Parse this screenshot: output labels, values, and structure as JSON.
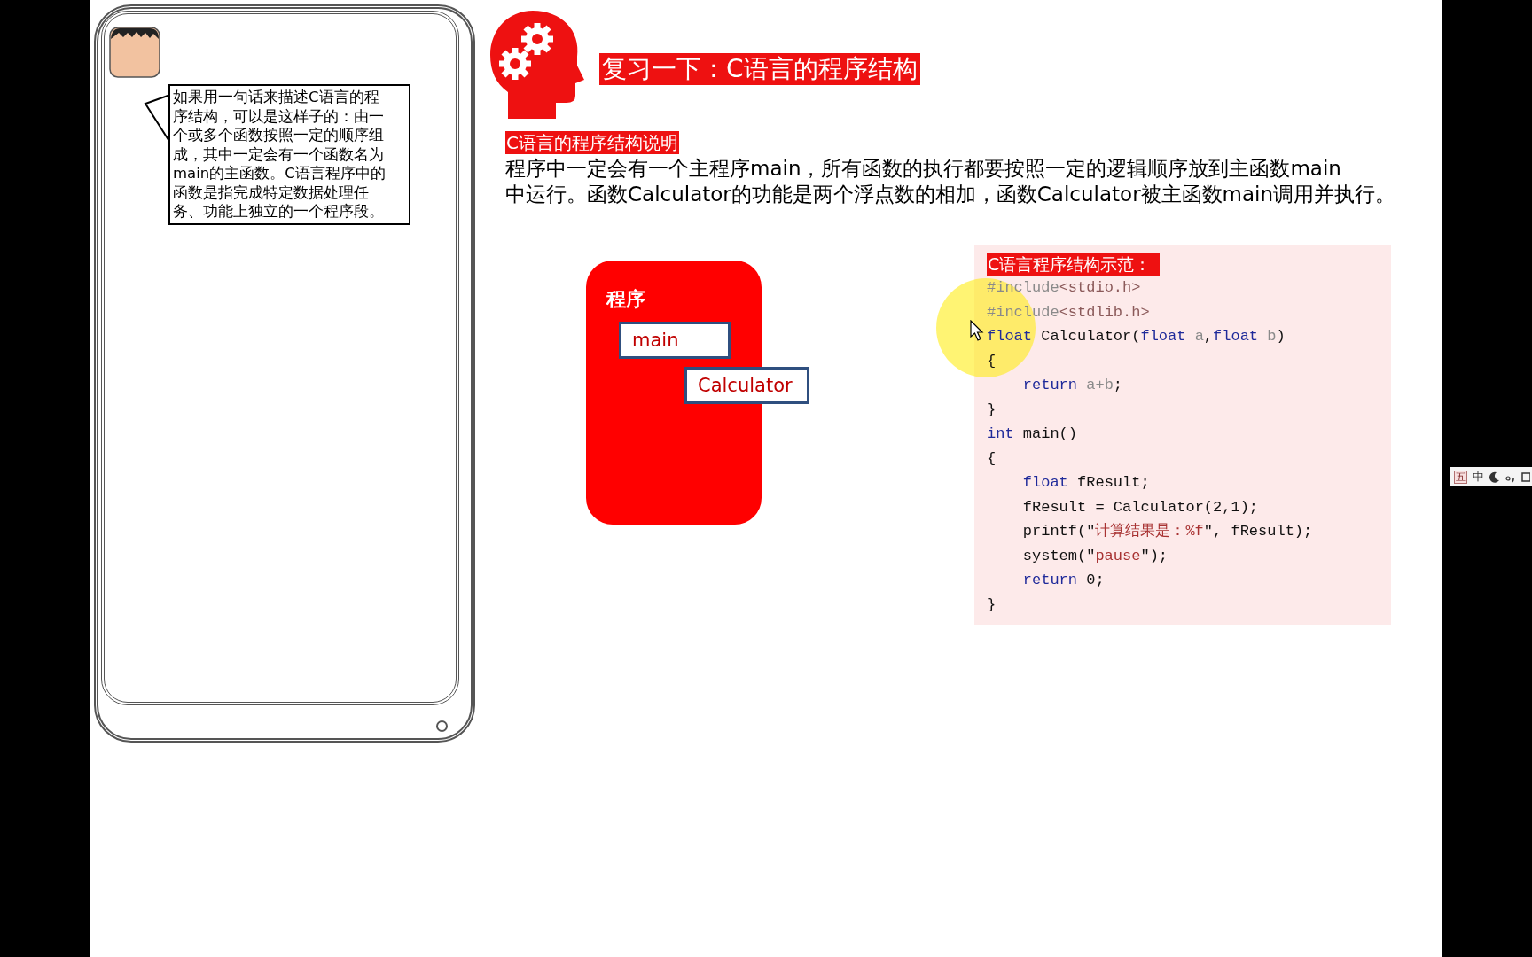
{
  "speech_bubble": {
    "text": "如果用一句话来描述C语言的程序结构，可以是这样子的：由一个或多个函数按照一定的顺序组成，其中一定会有一个函数名为main的主函数。C语言程序中的函数是指完成特定数据处理任务、功能上独立的一个程序段。"
  },
  "title": "复习一下：C语言的程序结构",
  "section_heading": "C语言的程序结构说明",
  "description": "程序中一定会有一个主程序main，所有函数的执行都要按照一定的逻辑顺序放到主函数main\n中运行。函数Calculator的功能是两个浮点数的相加，函数Calculator被主函数main调用并执行。",
  "diagram": {
    "label": "程序",
    "boxes": [
      "main",
      "Calculator"
    ]
  },
  "code_example": {
    "heading": "C语言程序结构示范：",
    "lines": [
      {
        "tokens": [
          {
            "text": "#include",
            "kind": "directive"
          },
          {
            "text": "<stdio.h>",
            "kind": "header"
          }
        ]
      },
      {
        "tokens": [
          {
            "text": "#include",
            "kind": "directive"
          },
          {
            "text": "<stdlib.h>",
            "kind": "header"
          }
        ]
      },
      {
        "tokens": [
          {
            "text": "float",
            "kind": "keyword"
          },
          {
            "text": " Calculator(",
            "kind": "plain"
          },
          {
            "text": "float",
            "kind": "keyword"
          },
          {
            "text": " a",
            "kind": "param"
          },
          {
            "text": ",",
            "kind": "plain"
          },
          {
            "text": "float",
            "kind": "keyword"
          },
          {
            "text": " b",
            "kind": "param"
          },
          {
            "text": ")",
            "kind": "plain"
          }
        ]
      },
      {
        "tokens": [
          {
            "text": "{",
            "kind": "plain"
          }
        ]
      },
      {
        "tokens": [
          {
            "text": "    return",
            "kind": "keyword"
          },
          {
            "text": " a+b",
            "kind": "param"
          },
          {
            "text": ";",
            "kind": "plain"
          }
        ]
      },
      {
        "tokens": [
          {
            "text": "}",
            "kind": "plain"
          }
        ]
      },
      {
        "tokens": [
          {
            "text": "int",
            "kind": "keyword"
          },
          {
            "text": " main()",
            "kind": "plain"
          }
        ]
      },
      {
        "tokens": [
          {
            "text": "{",
            "kind": "plain"
          }
        ]
      },
      {
        "tokens": [
          {
            "text": "    float",
            "kind": "keyword"
          },
          {
            "text": " fResult;",
            "kind": "plain"
          }
        ]
      },
      {
        "tokens": [
          {
            "text": "    fResult = Calculator(2,1);",
            "kind": "plain"
          }
        ]
      },
      {
        "tokens": [
          {
            "text": "    printf(\"",
            "kind": "plain"
          },
          {
            "text": "计算结果是：%f",
            "kind": "string"
          },
          {
            "text": "\", fResult);",
            "kind": "plain"
          }
        ]
      },
      {
        "tokens": [
          {
            "text": "    system(\"",
            "kind": "plain"
          },
          {
            "text": "pause",
            "kind": "string"
          },
          {
            "text": "\");",
            "kind": "plain"
          }
        ]
      },
      {
        "tokens": [
          {
            "text": "    return",
            "kind": "keyword"
          },
          {
            "text": " 0;",
            "kind": "plain"
          }
        ]
      },
      {
        "tokens": [
          {
            "text": "}",
            "kind": "plain"
          }
        ]
      }
    ]
  },
  "ime_toolbar": {
    "mode_icon": "五",
    "language": "中"
  }
}
